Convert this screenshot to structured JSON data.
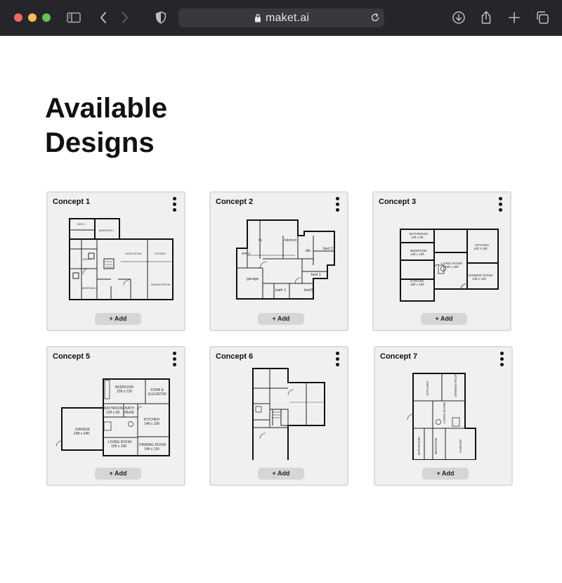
{
  "browser": {
    "url": "maket.ai",
    "icons": [
      "sidebar-icon",
      "back-icon",
      "forward-icon",
      "shield-icon",
      "lock-icon",
      "reload-icon",
      "download-icon",
      "share-icon",
      "new-tab-icon",
      "tabs-overview-icon"
    ]
  },
  "page": {
    "title": "Available Designs"
  },
  "cards": [
    {
      "title": "Concept 1",
      "add_label": "+ Add",
      "plan_labels": {
        "bath": "BATH 2",
        "bed": "BEDROOM 3",
        "bath2": "BATH 1",
        "bed2": "BEDROOM 2",
        "living": "LIVING ROOM",
        "kitchen": "KITCHEN",
        "dining": "DINNING ROOM"
      }
    },
    {
      "title": "Concept 2",
      "add_label": "+ Add",
      "plan_labels": {
        "liv": "liv",
        "kitchen": "kitchen",
        "entry": "entry",
        "garage": "garage",
        "bath1": "bath 1",
        "bed1": "bed 1",
        "bed2": "bed 2",
        "bed3": "bed3",
        "din": "din"
      }
    },
    {
      "title": "Concept 3",
      "add_label": "+ Add",
      "plan_labels": {
        "bathroom": "BATHROOM",
        "bathroom_dim": "12ft x 6ft",
        "bedroom": "BEDROOM",
        "bedroom_dim": "14ft x 10ft",
        "kitchen": "KITCHEN",
        "kitchen_dim": "14ft x 15ft",
        "living": "LIVING ROOM",
        "living_dim": "15ft x 20ft",
        "garage": "GARAGE",
        "garage_dim": "16ft x 16ft",
        "dining": "DINNING ROOM",
        "dining_dim": "14ft x 12ft"
      }
    },
    {
      "title": "Concept 5",
      "add_label": "+ Add",
      "plan_labels": {
        "bedroom": "BEDROOM",
        "bedroom_dim": "15ft x 12ft",
        "stair": "STAIR &",
        "elevator": "ELEVATOR",
        "bathroom": "BATHROOM",
        "bathroom_dim": "12ft x 6ft",
        "bath": "BATH",
        "bath_dim": "6ftx6ft",
        "garage": "GARAGE",
        "garage_dim": "24ft x 24ft",
        "kitchen": "KITCHEN",
        "kitchen_dim": "14ft x 15ft",
        "living": "LIVING ROOM",
        "living_dim": "15ft x 19ft",
        "dining": "DINNING ROOM",
        "dining_dim": "14ft x 11ft"
      }
    },
    {
      "title": "Concept 6",
      "add_label": "+ Add",
      "plan_labels": {}
    },
    {
      "title": "Concept 7",
      "add_label": "+ Add",
      "plan_labels": {
        "kitchen": "KITCHEN",
        "dining": "DINNING ROOM",
        "living": "LIVING ROOM",
        "bathroom": "BATHROOM",
        "bedroom": "BEDROOM",
        "garage": "GARAGE"
      }
    }
  ]
}
